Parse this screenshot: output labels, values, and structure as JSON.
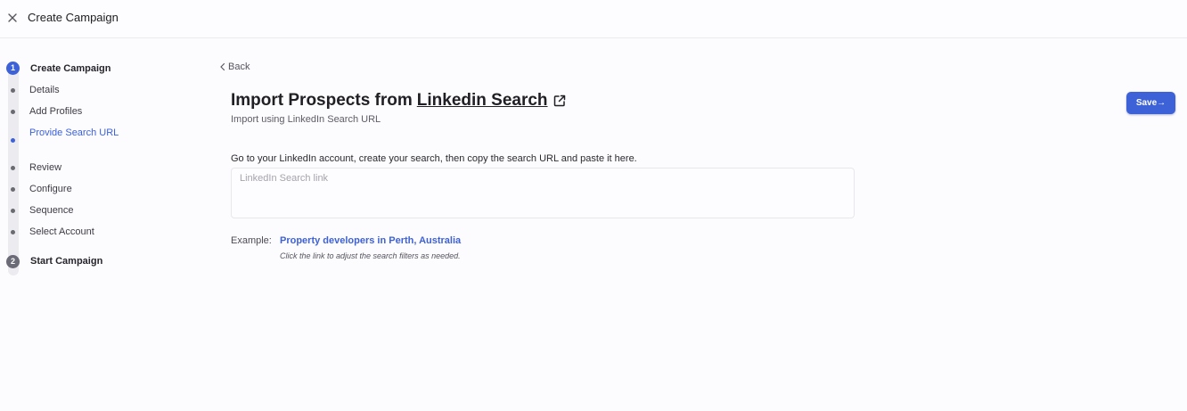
{
  "header": {
    "title": "Create Campaign",
    "close_icon": "close-icon"
  },
  "stepper": {
    "steps": [
      {
        "number": "1",
        "title": "Create Campaign"
      },
      {
        "number": "2",
        "title": "Start Campaign"
      }
    ],
    "substeps": [
      "Details",
      "Add Profiles",
      "Provide Search URL",
      "Review",
      "Configure",
      "Sequence",
      "Select Account"
    ],
    "active_substep": "Provide Search URL"
  },
  "main": {
    "back_label": "Back",
    "title_prefix": "Import Prospects from",
    "title_link": "Linkedin Search",
    "subtitle": "Import using LinkedIn Search URL",
    "save_label": "Save→",
    "instruction": "Go to your LinkedIn account, create your search, then copy the search URL and paste it here.",
    "input": {
      "placeholder": "LinkedIn Search link",
      "value": ""
    },
    "example_label": "Example:",
    "example_link": "Property developers in Perth, Australia",
    "example_hint": "Click the link to adjust the search filters as needed."
  },
  "colors": {
    "accent": "#3d62d8",
    "background": "#fcfbfd",
    "text": "#1f1f24"
  }
}
